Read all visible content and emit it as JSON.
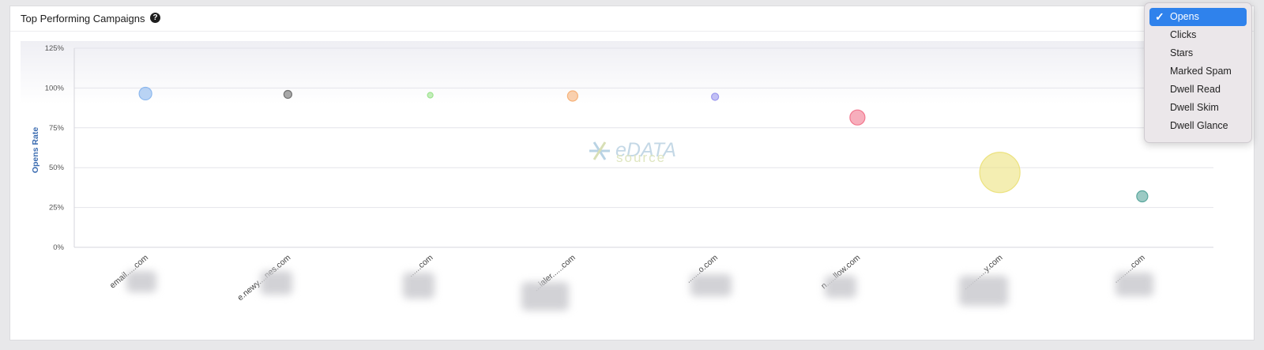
{
  "panel": {
    "title": "Top Performing Campaigns",
    "help_icon": "question-circle-icon"
  },
  "dropdown": {
    "selected": "Opens",
    "options": [
      "Opens",
      "Clicks",
      "Stars",
      "Marked Spam",
      "Dwell Read",
      "Dwell Skim",
      "Dwell Glance"
    ]
  },
  "watermark": {
    "word1": "eDATA",
    "word2": "source"
  },
  "chart_data": {
    "type": "scatter",
    "title": "",
    "ylabel": "Opens Rate",
    "xlabel": "",
    "ylim": [
      0,
      125
    ],
    "y_ticks": [
      "0%",
      "25%",
      "50%",
      "75%",
      "100%",
      "125%"
    ],
    "grid": true,
    "categories": [
      "email.....com",
      "e.newy....nes.com",
      "......com",
      "...ialer......com",
      ".......o.com",
      "n.....llow.com",
      "............y.com",
      "..........com"
    ],
    "values": [
      96.5,
      96,
      95.5,
      95,
      94.5,
      81.5,
      47,
      32
    ],
    "bubble_size": [
      8,
      5,
      3.5,
      6.5,
      4.5,
      9.5,
      25.5,
      7
    ],
    "colors": [
      "#8cb8ee",
      "#707070",
      "#9ce38e",
      "#f6b27a",
      "#9b98ee",
      "#f2788f",
      "#ece27f",
      "#5aa79d"
    ]
  }
}
